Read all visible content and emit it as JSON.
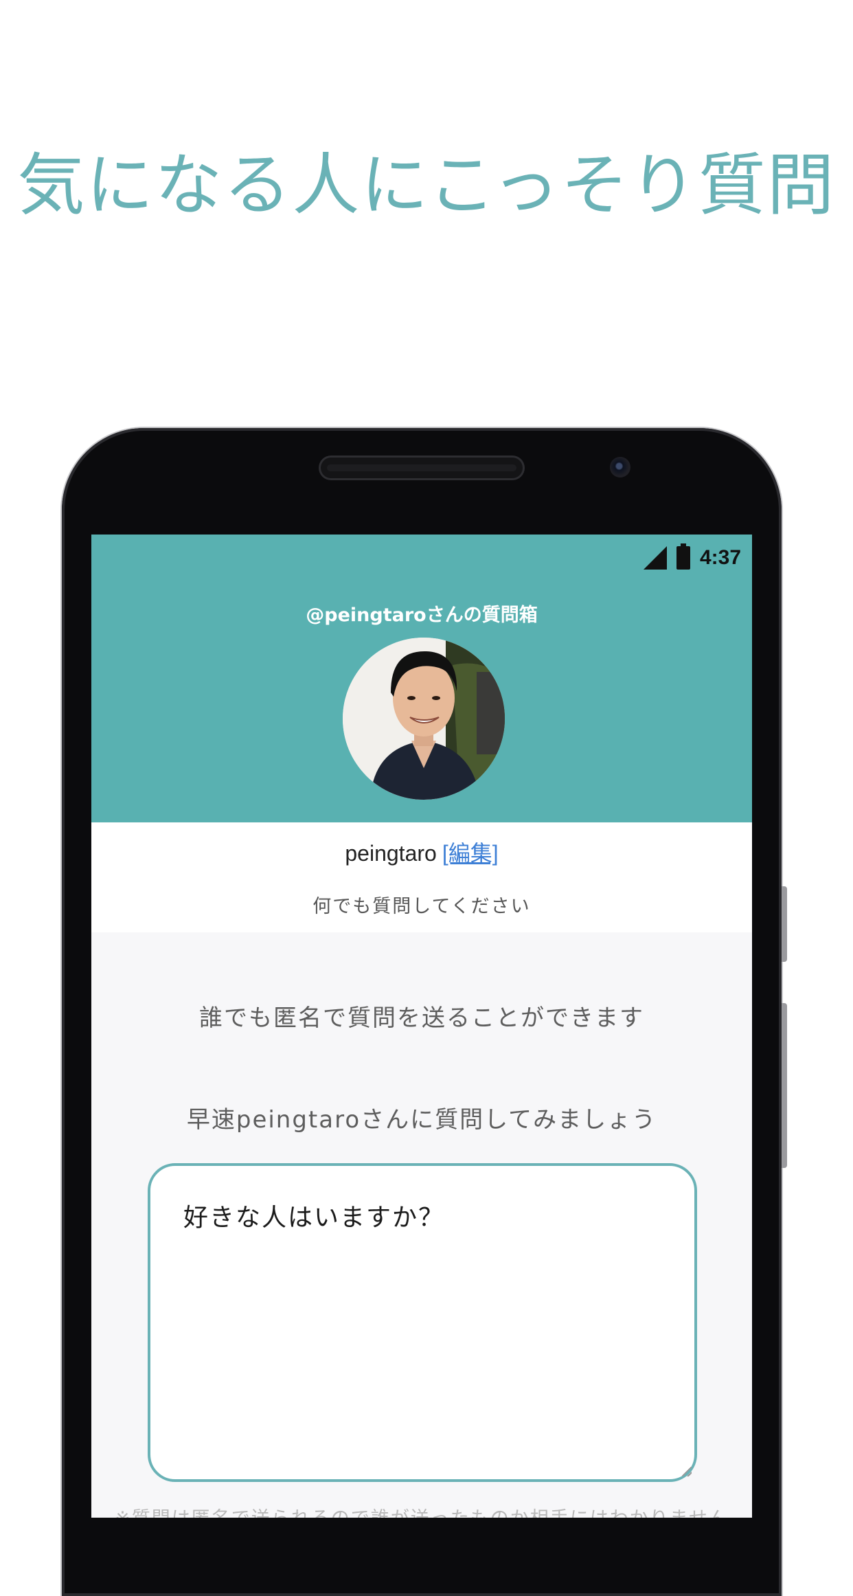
{
  "promo": {
    "headline": "気になる人にこっそり質問"
  },
  "status_bar": {
    "time": "4:37",
    "signal_icon": "cell-signal-icon",
    "battery_icon": "battery-icon"
  },
  "header": {
    "box_title": "@peingtaroさんの質問箱",
    "bg_color": "#59b1b1"
  },
  "profile": {
    "name": "peingtaro",
    "edit_label": "[編集]",
    "message": "何でも質問してください"
  },
  "main": {
    "info_anonymous": "誰でも匿名で質問を送ることができます",
    "info_prompt": "早速peingtaroさんに質問してみましょう",
    "question_value": "好きな人はいますか？",
    "footer_note": "※質問は匿名で送られるので誰が送ったものか相手にはわかりません"
  },
  "colors": {
    "accent": "#6ab2b6",
    "link": "#3d7fd6"
  }
}
